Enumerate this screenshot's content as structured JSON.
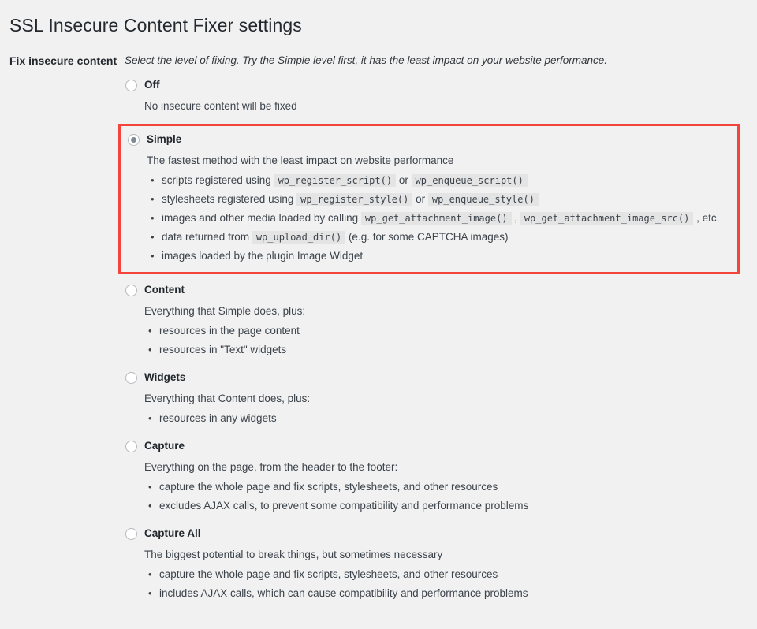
{
  "page": {
    "title": "SSL Insecure Content Fixer settings"
  },
  "colors": {
    "background": "#f1f1f1",
    "highlight_border": "#f4453c",
    "code_background": "#e4e4e4",
    "text": "#3c434a",
    "heading": "#23282d"
  },
  "field": {
    "label": "Fix insecure content",
    "description": "Select the level of fixing. Try the Simple level first, it has the least impact on your website performance."
  },
  "options": [
    {
      "id": "off",
      "label": "Off",
      "selected": false,
      "highlighted": false,
      "intro": "No insecure content will be fixed",
      "bullets": []
    },
    {
      "id": "simple",
      "label": "Simple",
      "selected": true,
      "highlighted": true,
      "intro": "The fastest method with the least impact on website performance",
      "bullets": [
        [
          {
            "t": "text",
            "v": "scripts registered using "
          },
          {
            "t": "code",
            "v": "wp_register_script()"
          },
          {
            "t": "text",
            "v": " or "
          },
          {
            "t": "code",
            "v": "wp_enqueue_script()"
          }
        ],
        [
          {
            "t": "text",
            "v": "stylesheets registered using "
          },
          {
            "t": "code",
            "v": "wp_register_style()"
          },
          {
            "t": "text",
            "v": " or "
          },
          {
            "t": "code",
            "v": "wp_enqueue_style()"
          }
        ],
        [
          {
            "t": "text",
            "v": "images and other media loaded by calling "
          },
          {
            "t": "code",
            "v": "wp_get_attachment_image()"
          },
          {
            "t": "text",
            "v": " , "
          },
          {
            "t": "code",
            "v": "wp_get_attachment_image_src()"
          },
          {
            "t": "text",
            "v": " , etc."
          }
        ],
        [
          {
            "t": "text",
            "v": "data returned from "
          },
          {
            "t": "code",
            "v": "wp_upload_dir()"
          },
          {
            "t": "text",
            "v": " (e.g. for some CAPTCHA images)"
          }
        ],
        [
          {
            "t": "text",
            "v": "images loaded by the plugin Image Widget"
          }
        ]
      ]
    },
    {
      "id": "content",
      "label": "Content",
      "selected": false,
      "highlighted": false,
      "intro": "Everything that Simple does, plus:",
      "bullets": [
        [
          {
            "t": "text",
            "v": "resources in the page content"
          }
        ],
        [
          {
            "t": "text",
            "v": "resources in \"Text\" widgets"
          }
        ]
      ]
    },
    {
      "id": "widgets",
      "label": "Widgets",
      "selected": false,
      "highlighted": false,
      "intro": "Everything that Content does, plus:",
      "bullets": [
        [
          {
            "t": "text",
            "v": "resources in any widgets"
          }
        ]
      ]
    },
    {
      "id": "capture",
      "label": "Capture",
      "selected": false,
      "highlighted": false,
      "intro": "Everything on the page, from the header to the footer:",
      "bullets": [
        [
          {
            "t": "text",
            "v": "capture the whole page and fix scripts, stylesheets, and other resources"
          }
        ],
        [
          {
            "t": "text",
            "v": "excludes AJAX calls, to prevent some compatibility and performance problems"
          }
        ]
      ]
    },
    {
      "id": "capture_all",
      "label": "Capture All",
      "selected": false,
      "highlighted": false,
      "intro": "The biggest potential to break things, but sometimes necessary",
      "bullets": [
        [
          {
            "t": "text",
            "v": "capture the whole page and fix scripts, stylesheets, and other resources"
          }
        ],
        [
          {
            "t": "text",
            "v": "includes AJAX calls, which can cause compatibility and performance problems"
          }
        ]
      ]
    }
  ]
}
